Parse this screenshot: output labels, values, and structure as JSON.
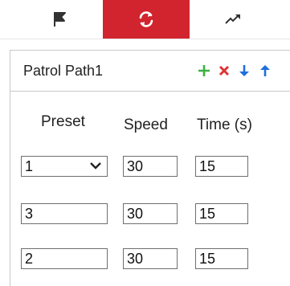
{
  "tabs": [
    {
      "icon": "flag-icon",
      "active": false
    },
    {
      "icon": "refresh-icon",
      "active": true
    },
    {
      "icon": "trend-icon",
      "active": false
    }
  ],
  "colors": {
    "active_tab": "#d1242f",
    "add": "#3cb043",
    "delete": "#e03232",
    "move": "#1e6fd9"
  },
  "patrol": {
    "name": "Patrol Path1"
  },
  "toolbar": {
    "add_icon": "plus-icon",
    "delete_icon": "x-icon",
    "down_icon": "arrow-down-icon",
    "up_icon": "arrow-up-icon"
  },
  "columns": {
    "preset": "Preset",
    "speed": "Speed",
    "time": "Time (s)"
  },
  "rows": [
    {
      "preset": "1",
      "speed": "30",
      "time": "15"
    },
    {
      "preset": "3",
      "speed": "30",
      "time": "15"
    },
    {
      "preset": "2",
      "speed": "30",
      "time": "15"
    }
  ]
}
